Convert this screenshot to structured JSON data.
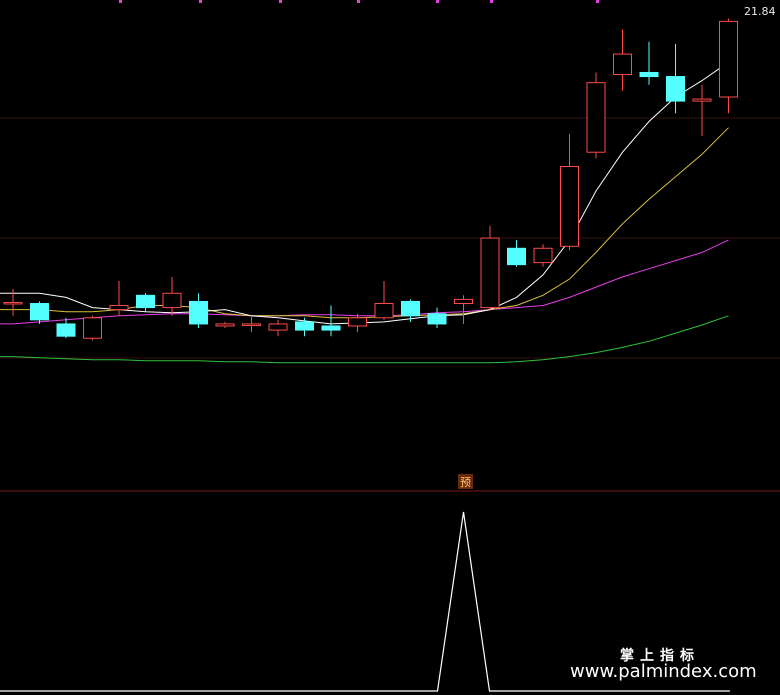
{
  "chart_data": {
    "type": "candlestick",
    "price_label": "21.84",
    "badge": "预",
    "watermark": {
      "cn": "掌上指标",
      "en": "www.palmindex.com"
    },
    "ylim": [
      0,
      22.5
    ],
    "candles": [
      {
        "o": 7.9,
        "c": 7.95,
        "h": 8.6,
        "l": 7.3
      },
      {
        "o": 7.9,
        "c": 7.1,
        "h": 8.0,
        "l": 6.9
      },
      {
        "o": 6.9,
        "c": 6.3,
        "h": 7.2,
        "l": 6.2
      },
      {
        "o": 6.2,
        "c": 7.2,
        "h": 7.3,
        "l": 6.1
      },
      {
        "o": 7.6,
        "c": 7.8,
        "h": 9.0,
        "l": 7.3
      },
      {
        "o": 8.3,
        "c": 7.7,
        "h": 8.4,
        "l": 7.5
      },
      {
        "o": 7.7,
        "c": 8.4,
        "h": 9.2,
        "l": 7.3
      },
      {
        "o": 8.0,
        "c": 6.9,
        "h": 8.4,
        "l": 6.7
      },
      {
        "o": 6.8,
        "c": 6.9,
        "h": 7.0,
        "l": 6.7
      },
      {
        "o": 6.9,
        "c": 6.9,
        "h": 7.3,
        "l": 6.5
      },
      {
        "o": 6.6,
        "c": 6.9,
        "h": 7.1,
        "l": 6.3
      },
      {
        "o": 7.0,
        "c": 6.6,
        "h": 7.2,
        "l": 6.3
      },
      {
        "o": 6.8,
        "c": 6.6,
        "h": 7.8,
        "l": 6.3
      },
      {
        "o": 6.8,
        "c": 7.2,
        "h": 7.4,
        "l": 6.5
      },
      {
        "o": 7.2,
        "c": 7.9,
        "h": 9.0,
        "l": 7.1
      },
      {
        "o": 8.0,
        "c": 7.3,
        "h": 8.1,
        "l": 7.0
      },
      {
        "o": 7.4,
        "c": 6.9,
        "h": 7.7,
        "l": 6.7
      },
      {
        "o": 7.9,
        "c": 8.1,
        "h": 8.3,
        "l": 6.9
      },
      {
        "o": 7.7,
        "c": 11.1,
        "h": 11.7,
        "l": 7.6
      },
      {
        "o": 10.6,
        "c": 9.8,
        "h": 11.0,
        "l": 9.7
      },
      {
        "o": 9.9,
        "c": 10.6,
        "h": 10.8,
        "l": 9.7
      },
      {
        "o": 10.7,
        "c": 14.6,
        "h": 16.2,
        "l": 10.5
      },
      {
        "o": 15.3,
        "c": 18.7,
        "h": 19.2,
        "l": 15.0
      },
      {
        "o": 19.1,
        "c": 20.1,
        "h": 21.3,
        "l": 18.3
      },
      {
        "o": 19.2,
        "c": 19.0,
        "h": 20.7,
        "l": 18.6
      },
      {
        "o": 19.0,
        "c": 17.8,
        "h": 20.6,
        "l": 17.2
      },
      {
        "o": 17.8,
        "c": 17.9,
        "h": 18.6,
        "l": 16.1
      },
      {
        "o": 18.0,
        "c": 21.7,
        "h": 21.84,
        "l": 17.2
      }
    ],
    "ma_white": [
      8.4,
      8.4,
      8.2,
      7.7,
      7.6,
      7.5,
      7.45,
      7.5,
      7.6,
      7.3,
      7.2,
      7.05,
      6.9,
      6.95,
      7.0,
      7.15,
      7.3,
      7.35,
      7.6,
      8.2,
      9.3,
      11.0,
      13.4,
      15.3,
      16.8,
      18.0,
      18.8,
      19.7
    ],
    "ma_yellow": [
      7.6,
      7.6,
      7.5,
      7.5,
      7.6,
      7.8,
      7.8,
      7.7,
      7.4,
      7.3,
      7.3,
      7.3,
      7.2,
      7.2,
      7.25,
      7.3,
      7.35,
      7.4,
      7.6,
      7.8,
      8.3,
      9.1,
      10.4,
      11.8,
      13.0,
      14.1,
      15.2,
      16.5
    ],
    "ma_magenta": [
      6.9,
      7.0,
      7.1,
      7.2,
      7.3,
      7.35,
      7.4,
      7.4,
      7.35,
      7.3,
      7.3,
      7.35,
      7.35,
      7.3,
      7.3,
      7.35,
      7.45,
      7.5,
      7.6,
      7.7,
      7.8,
      8.2,
      8.7,
      9.2,
      9.6,
      10.0,
      10.4,
      11.0
    ],
    "ma_green": [
      5.3,
      5.25,
      5.2,
      5.15,
      5.15,
      5.1,
      5.1,
      5.1,
      5.05,
      5.05,
      5.0,
      5.0,
      5.0,
      5.0,
      5.0,
      5.0,
      5.0,
      5.0,
      5.0,
      5.05,
      5.15,
      5.3,
      5.5,
      5.75,
      6.05,
      6.45,
      6.85,
      7.3
    ],
    "indicator": [
      0,
      0,
      0,
      0,
      0,
      0,
      0,
      0,
      0,
      0,
      0,
      0,
      0,
      0,
      0,
      0,
      0,
      1,
      0,
      0,
      0,
      0,
      0,
      0,
      0,
      0,
      0,
      0
    ],
    "colors": {
      "bg": "#000000",
      "up": "#ff4a4a",
      "down": "#54ffff",
      "ma_white": "#ffffff",
      "ma_yellow": "#d7c13a",
      "ma_magenta": "#e83ee8",
      "ma_green": "#31c23c",
      "divider": "#7a1a1a",
      "gridline": "#3a0d0d",
      "dot": "#e83ee8"
    }
  }
}
